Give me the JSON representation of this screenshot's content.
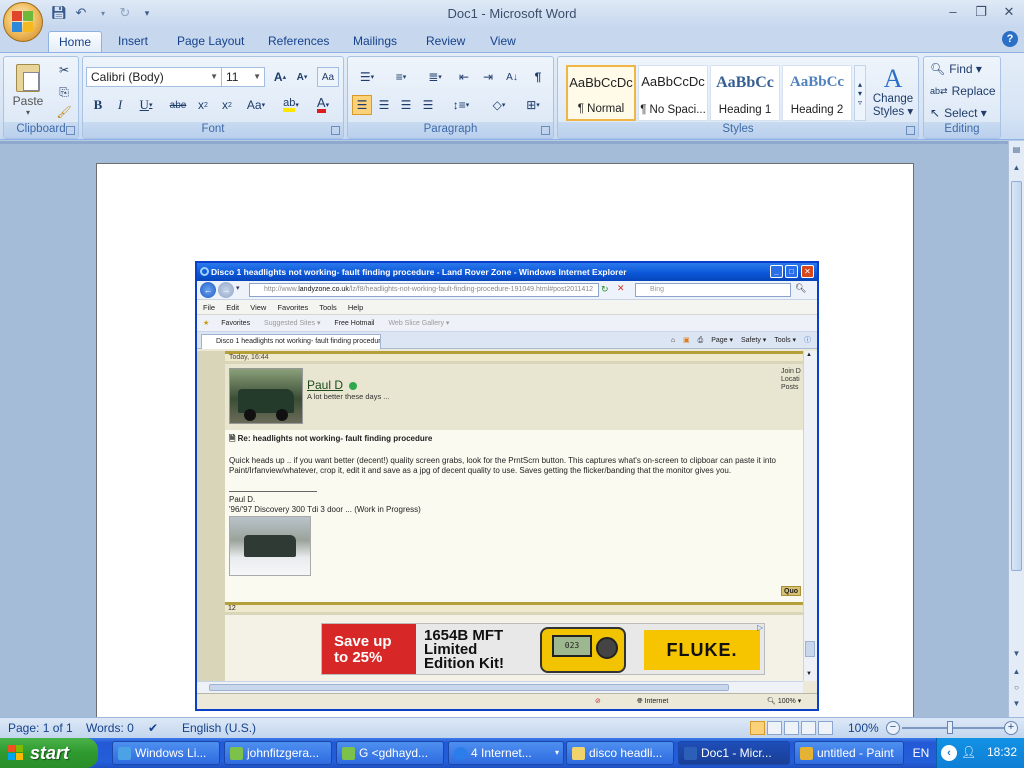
{
  "word": {
    "title": "Doc1 - Microsoft Word",
    "tabs": [
      "Home",
      "Insert",
      "Page Layout",
      "References",
      "Mailings",
      "Review",
      "View"
    ],
    "active_tab": "Home",
    "clipboard": {
      "paste": "Paste",
      "label": "Clipboard"
    },
    "font": {
      "name": "Calibri (Body)",
      "size": "11",
      "label": "Font"
    },
    "paragraph": {
      "label": "Paragraph"
    },
    "styles": {
      "label": "Styles",
      "items": [
        {
          "preview": "AaBbCcDc",
          "name": "¶ Normal"
        },
        {
          "preview": "AaBbCcDc",
          "name": "¶ No Spaci..."
        },
        {
          "preview": "AaBbCc",
          "name": "Heading 1"
        },
        {
          "preview": "AaBbCc",
          "name": "Heading 2"
        }
      ],
      "change_styles_1": "Change",
      "change_styles_2": "Styles ▾"
    },
    "editing": {
      "find": "Find ▾",
      "replace": "Replace",
      "select": "Select ▾",
      "label": "Editing"
    },
    "status": {
      "page": "Page: 1 of 1",
      "words": "Words: 0",
      "language": "English (U.S.)",
      "zoom": "100%"
    }
  },
  "ie": {
    "title": "Disco 1 headlights not working- fault finding procedure - Land Rover Zone - Windows Internet Explorer",
    "url_prefix": "http://www.",
    "url_domain": "landyzone.co.uk",
    "url_rest": "/lz/f8/headlights-not-working-fault-finding-procedure-191049.html#post2011412",
    "search_placeholder": "Bing",
    "menu": [
      "File",
      "Edit",
      "View",
      "Favorites",
      "Tools",
      "Help"
    ],
    "favbar": [
      "Favorites",
      "Suggested Sites ▾",
      "Free Hotmail",
      "Web Slice Gallery ▾"
    ],
    "tab_title": "Disco 1 headlights not working- fault finding procedur...",
    "tools": [
      "Page ▾",
      "Safety ▾",
      "Tools ▾"
    ],
    "post_date": "Today, 16:44",
    "username": "Paul D",
    "user_title": "A lot better these days ...",
    "join_labels": [
      "Join D",
      "Locati",
      "Posts"
    ],
    "post_title": "Re: headlights not working- fault finding procedure",
    "post_body": "Quick heads up .. if you want better (decent!) quality screen grabs, look for the PrntScrn button. This captures what's on-screen to clipboar can paste it into Paint/Irfanview/whatever, crop it, edit it and save as a jpg of decent quality to use. Saves getting the flicker/banding that the monitor gives you.",
    "sig_name": "Paul D.",
    "sig_line": "'96/'97 Discovery 300 Tdi 3 door ... (Work in Progress)",
    "quote_btn": "Quo",
    "post_number": "12",
    "ad": {
      "save_line1": "Save up",
      "save_line2": "to 25%",
      "product_line1": "1654B MFT",
      "product_line2": "Limited",
      "product_line3": "Edition Kit!",
      "meter_display": "023",
      "brand": "FLUKE."
    },
    "status_zone": "Internet",
    "status_zoom": "100%"
  },
  "taskbar": {
    "start": "start",
    "items": [
      "Windows Li...",
      "johnfitzgera...",
      "G <gdhayd...",
      "4 Internet...",
      "disco headli...",
      "Doc1 - Micr...",
      "untitled - Paint"
    ],
    "language": "EN",
    "clock": "18:32"
  }
}
